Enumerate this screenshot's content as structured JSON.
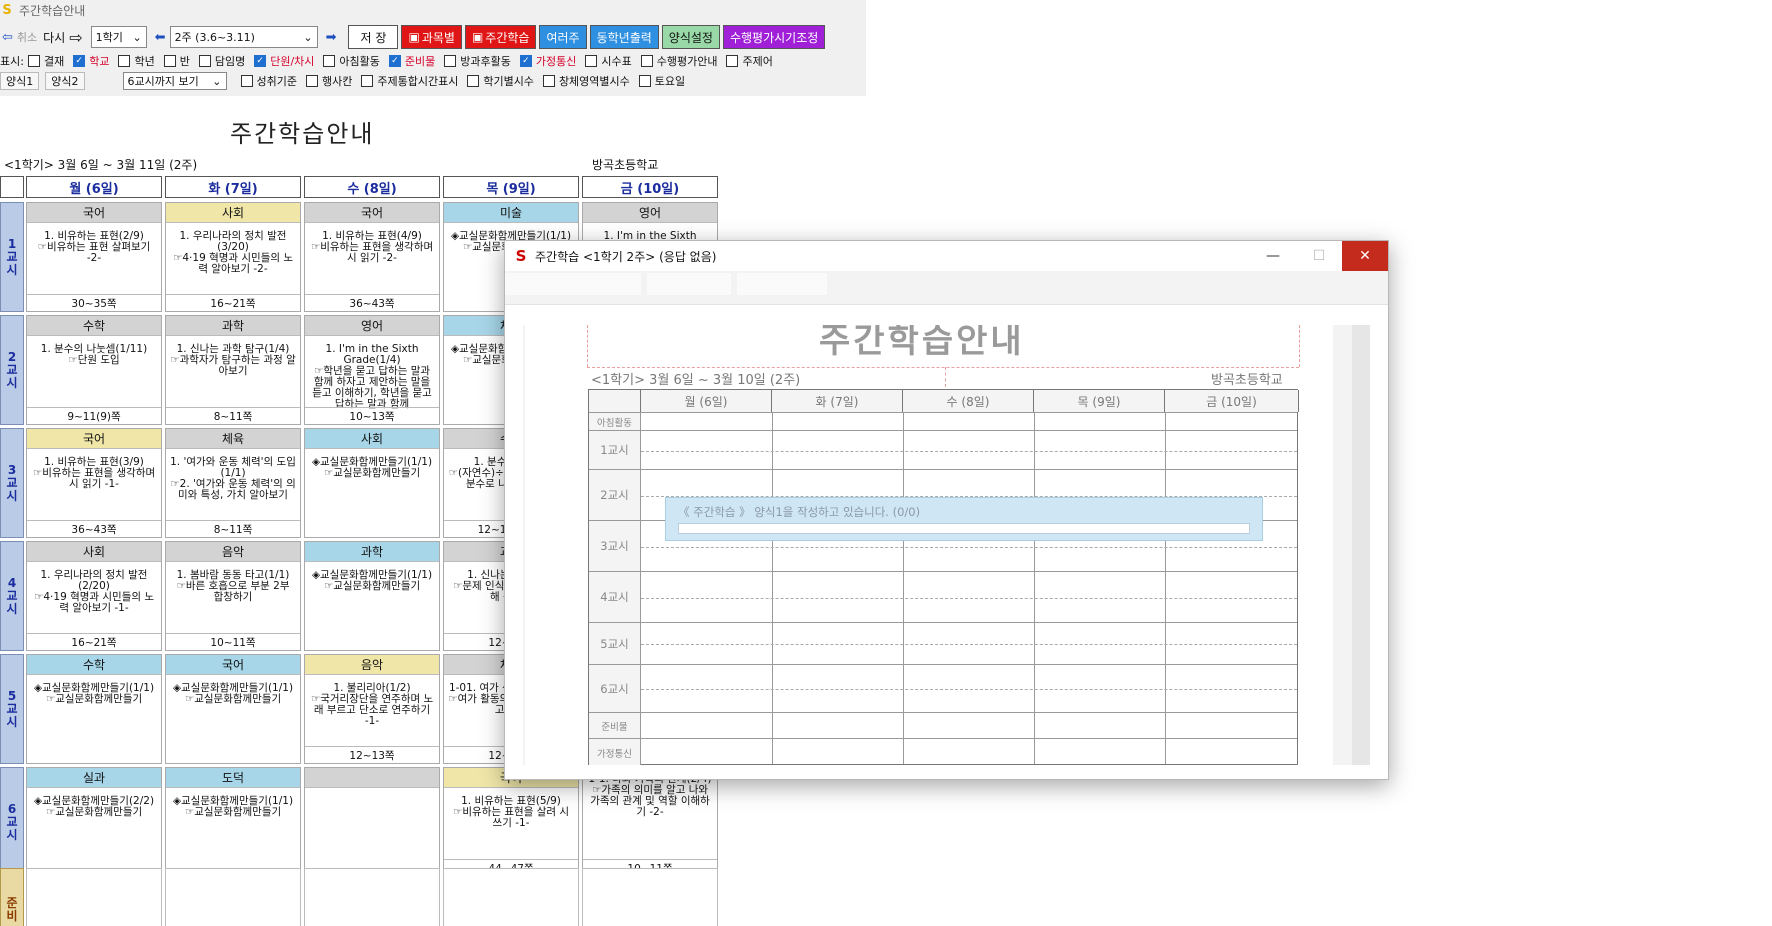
{
  "app": {
    "title": "주간학습안내",
    "logo": "S"
  },
  "toolbar": {
    "undo": "취소",
    "redo": "다시",
    "semester": "1학기",
    "week": "2주 (3.6~3.11)",
    "save": "저 장",
    "by_subject": "과목별",
    "weekly_study": "주간학습",
    "multi_week": "여러주",
    "same_grade_print": "동학년출력",
    "form_settings": "양식설정",
    "eval_adjust": "수행평가시기조정",
    "colors": {
      "by_subject": "#e01515",
      "weekly_study": "#e01515",
      "multi_week": "#2f8fe0",
      "same_grade_print": "#2f8fe0",
      "form_settings": "#99d9a8",
      "eval_adjust": "#a020d8"
    }
  },
  "filters": {
    "label": "표시:",
    "row1": [
      {
        "label": "결재",
        "checked": false,
        "red": false
      },
      {
        "label": "학교",
        "checked": true,
        "red": true
      },
      {
        "label": "학년",
        "checked": false,
        "red": false
      },
      {
        "label": "반",
        "checked": false,
        "red": false
      },
      {
        "label": "담임명",
        "checked": false,
        "red": false
      },
      {
        "label": "단원/차시",
        "checked": true,
        "red": true
      },
      {
        "label": "아침활동",
        "checked": false,
        "red": false
      },
      {
        "label": "준비물",
        "checked": true,
        "red": true
      },
      {
        "label": "방과후활동",
        "checked": false,
        "red": false
      },
      {
        "label": "가정통신",
        "checked": true,
        "red": true
      },
      {
        "label": "시수표",
        "checked": false,
        "red": false
      },
      {
        "label": "수행평가안내",
        "checked": false,
        "red": false
      },
      {
        "label": "주제어",
        "checked": false,
        "red": false
      }
    ],
    "tabs": [
      "양식1",
      "양식2"
    ],
    "period_select": "6교시까지 보기",
    "row2": [
      {
        "label": "성취기준",
        "checked": false
      },
      {
        "label": "행사칸",
        "checked": false
      },
      {
        "label": "주제통합시간표시",
        "checked": false
      },
      {
        "label": "학기별시수",
        "checked": false
      },
      {
        "label": "창체영역별시수",
        "checked": false
      },
      {
        "label": "토요일",
        "checked": false
      }
    ]
  },
  "doc": {
    "title": "주간학습안내",
    "subtitle": "<1학기> 3월 6일 ~ 3월 11일 (2주)",
    "school": "방곡초등학교",
    "days": [
      "월 (6일)",
      "화 (7일)",
      "수 (8일)",
      "목 (9일)",
      "금 (10일)"
    ],
    "periods": [
      "1\n교\n시",
      "2\n교\n시",
      "3\n교\n시",
      "4\n교\n시",
      "5\n교\n시",
      "6\n교\n시"
    ],
    "prep_label": "준\n비",
    "cells": [
      [
        {
          "subject": "국어",
          "color": "gray",
          "body": "1. 비유하는 표현(2/9)\n☞비유하는 표현 살펴보기 -2-",
          "pages": "30~35쪽"
        },
        {
          "subject": "사회",
          "color": "yellow",
          "body": "1. 우리나라의 정치 발전(3/20)\n☞4·19 혁명과 시민들의 노력 알아보기 -2-",
          "pages": "16~21쪽"
        },
        {
          "subject": "국어",
          "color": "gray",
          "body": "1. 비유하는 표현(4/9)\n☞비유하는 표현을 생각하며 시 읽기 -2-",
          "pages": "36~43쪽"
        },
        {
          "subject": "미술",
          "color": "blue",
          "body": "◈교실문화함께만들기(1/1)\n☞교실문화함께만들기",
          "pages": ""
        },
        {
          "subject": "영어",
          "color": "gray",
          "body": "1. I'm in the Sixth",
          "pages": ""
        }
      ],
      [
        {
          "subject": "수학",
          "color": "gray",
          "body": "1. 분수의 나눗셈(1/11)\n☞단원 도입",
          "pages": "9~11(9)쪽"
        },
        {
          "subject": "과학",
          "color": "gray",
          "body": "1. 신나는 과학 탐구(1/4)\n☞과학자가 탐구하는 과정 알아보기",
          "pages": "8~11쪽"
        },
        {
          "subject": "영어",
          "color": "gray",
          "body": "1. I'm in the Sixth Grade(1/4)\n☞학년을 묻고 답하는 말과 함께 하자고 제안하는 말을 듣고 이해하기, 학년을 묻고 답하는 말과 함께",
          "pages": "10~13쪽"
        },
        {
          "subject": "체육",
          "color": "blue",
          "body": "◈교실문화함께만들기(1/1)\n☞교실문화함께만들기",
          "pages": ""
        },
        {
          "subject": "",
          "color": "none",
          "body": "",
          "pages": ""
        }
      ],
      [
        {
          "subject": "국어",
          "color": "yellow",
          "body": "1. 비유하는 표현(3/9)\n☞비유하는 표현을 생각하며 시 읽기 -1-",
          "pages": "36~43쪽"
        },
        {
          "subject": "체육",
          "color": "gray",
          "body": "1. '여가와 운동 체력'의 도입(1/1)\n☞2. '여가와 운동 체력'의 의미와 특성, 가치 알아보기",
          "pages": "8~11쪽"
        },
        {
          "subject": "사회",
          "color": "blue",
          "body": "◈교실문화함께만들기(1/1)\n☞교실문화함께만들기",
          "pages": ""
        },
        {
          "subject": "수학",
          "color": "gray",
          "body": "1. 분수의 나눗셈\n☞(자연수)÷(자연수)의 몫을 분수로 나타내볼까요",
          "pages": "12~13(10)쪽"
        },
        {
          "subject": "",
          "color": "none",
          "body": "",
          "pages": ""
        }
      ],
      [
        {
          "subject": "사회",
          "color": "gray",
          "body": "1. 우리나라의 정치 발전(2/20)\n☞4·19 혁명과 시민들의 노력 알아보기 -1-",
          "pages": "16~21쪽"
        },
        {
          "subject": "음악",
          "color": "gray",
          "body": "1. 봄바람 동동 타고(1/1)\n☞바른 호흡으로 부분 2부 합창하기",
          "pages": "10~11쪽"
        },
        {
          "subject": "과학",
          "color": "blue",
          "body": "◈교실문화함께만들기(1/1)\n☞교실문화함께만들기",
          "pages": ""
        },
        {
          "subject": "과학",
          "color": "gray",
          "body": "1. 신나는 과학 탐구\n☞문제 인식과 가설 설정을 해 봅시다",
          "pages": "12~13쪽"
        },
        {
          "subject": "",
          "color": "none",
          "body": "",
          "pages": ""
        }
      ],
      [
        {
          "subject": "수학",
          "color": "blue",
          "body": "◈교실문화함께만들기(1/1)\n☞교실문화함께만들기",
          "pages": ""
        },
        {
          "subject": "국어",
          "color": "blue",
          "body": "◈교실문화함께만들기(1/1)\n☞교실문화함께만들기",
          "pages": ""
        },
        {
          "subject": "음악",
          "color": "yellow",
          "body": "1. 불리리아(1/2)\n☞국거리장단을 연주하며 노래 부르고 단소로 연주하기 -1-",
          "pages": "12~13쪽"
        },
        {
          "subject": "체육",
          "color": "gray",
          "body": "1-01. 여가 생활을 건강하게\n☞여가 활동의 의미를 알아보고 계획",
          "pages": "12~13쪽"
        },
        {
          "subject": "",
          "color": "none",
          "body": "",
          "pages": ""
        }
      ],
      [
        {
          "subject": "실과",
          "color": "blue",
          "body": "◈교실문화함께만들기(2/2)\n☞교실문화함께만들기",
          "pages": ""
        },
        {
          "subject": "도덕",
          "color": "blue",
          "body": "◈교실문화함께만들기(1/1)\n☞교실문화함께만들기",
          "pages": ""
        },
        {
          "subject": "",
          "color": "gray",
          "body": "",
          "pages": ""
        },
        {
          "subject": "국어",
          "color": "yellow",
          "body": "1. 비유하는 표현(5/9)\n☞비유하는 표현을 살려 시 쓰기 -1-",
          "pages": "44~47쪽"
        },
        {
          "subject": "",
          "color": "none",
          "body": "1-1. 나와 가족의 관계(2/4)\n☞가족의 의미를 알고 나와 가족의 관계 및 역할 이해하기 -2-",
          "pages": "10~11쪽"
        }
      ]
    ]
  },
  "dialog": {
    "title": "주간학습 <1학기 2주> (응답 없음)",
    "minimize": "—",
    "maximize": "☐",
    "close": "✕",
    "preview": {
      "title": "주간학습안내",
      "subtitle": "<1학기> 3월 6일 ~ 3월 10일 (2주)",
      "school": "방곡초등학교",
      "days": [
        "월 (6일)",
        "화 (7일)",
        "수 (8일)",
        "목 (9일)",
        "금 (10일)"
      ],
      "rows": [
        "아침활동",
        "1교시",
        "2교시",
        "3교시",
        "4교시",
        "5교시",
        "6교시",
        "준비물",
        "가정통신"
      ]
    },
    "progress_text": "《 주간학습 》 양식1을 작성하고 있습니다. (0/0)",
    "progress_value": 0
  }
}
